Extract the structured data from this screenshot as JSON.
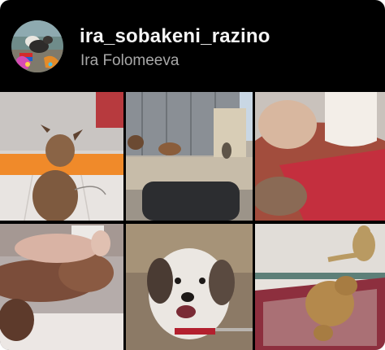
{
  "profile": {
    "username": "ira_sobakeni_razino",
    "full_name": "Ira Folomeeva",
    "avatar_icon": "profile-photo-dogs-with-flag"
  },
  "posts": [
    {
      "icon": "dog-on-orange-cushion-photo"
    },
    {
      "icon": "dogs-near-gate-photo"
    },
    {
      "icon": "dog-with-red-blanket-photo"
    },
    {
      "icon": "puppy-held-by-hand-photo"
    },
    {
      "icon": "smiling-terrier-photo"
    },
    {
      "icon": "cat-and-dog-on-rug-photo"
    }
  ],
  "colors": {
    "background": "#000000",
    "username_text": "#f5f5f5",
    "subtitle_text": "#a8a8a8"
  }
}
